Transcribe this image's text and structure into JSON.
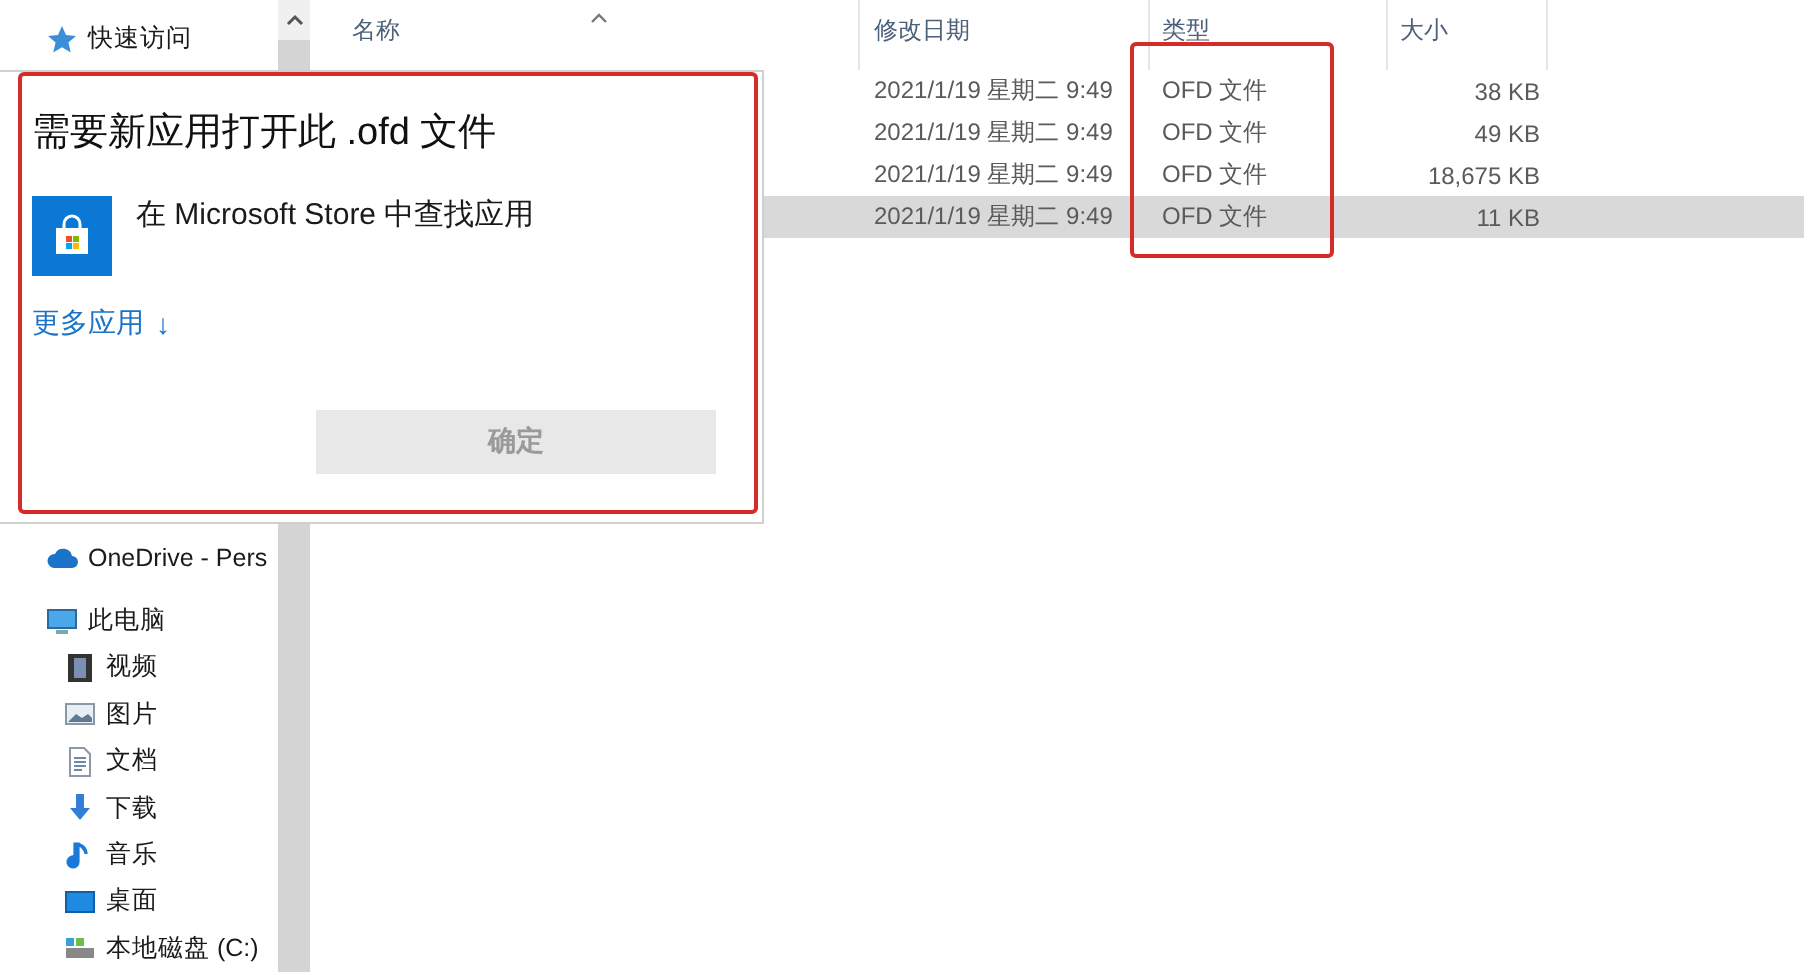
{
  "sidebar": {
    "items": [
      {
        "label": "快速访问"
      },
      {
        "label": "OneDrive - Pers"
      },
      {
        "label": "此电脑",
        "children": [
          {
            "label": "视频"
          },
          {
            "label": "图片"
          },
          {
            "label": "文档"
          },
          {
            "label": "下载"
          },
          {
            "label": "音乐"
          },
          {
            "label": "桌面"
          },
          {
            "label": "本地磁盘 (C:)"
          }
        ]
      }
    ]
  },
  "file_list": {
    "columns": [
      {
        "label": "名称",
        "sorted": true
      },
      {
        "label": "修改日期",
        "sorted": false
      },
      {
        "label": "类型",
        "sorted": false
      },
      {
        "label": "大小",
        "sorted": false
      }
    ],
    "rows": [
      {
        "modified": "2021/1/19 星期二 9:49",
        "type": "OFD 文件",
        "size": "38 KB",
        "selected": false
      },
      {
        "modified": "2021/1/19 星期二 9:49",
        "type": "OFD 文件",
        "size": "49 KB",
        "selected": false
      },
      {
        "modified": "2021/1/19 星期二 9:49",
        "type": "OFD 文件",
        "size": "18,675 KB",
        "selected": false
      },
      {
        "modified": "2021/1/19 星期二 9:49",
        "type": "OFD 文件",
        "size": "11 KB",
        "selected": true
      }
    ]
  },
  "dialog": {
    "title": "需要新应用打开此 .ofd 文件",
    "store_option": "在 Microsoft Store 中查找应用",
    "more_apps": {
      "label": "更多应用",
      "arrow": "↓"
    },
    "ok_button": {
      "label": "确定",
      "disabled": true
    }
  }
}
